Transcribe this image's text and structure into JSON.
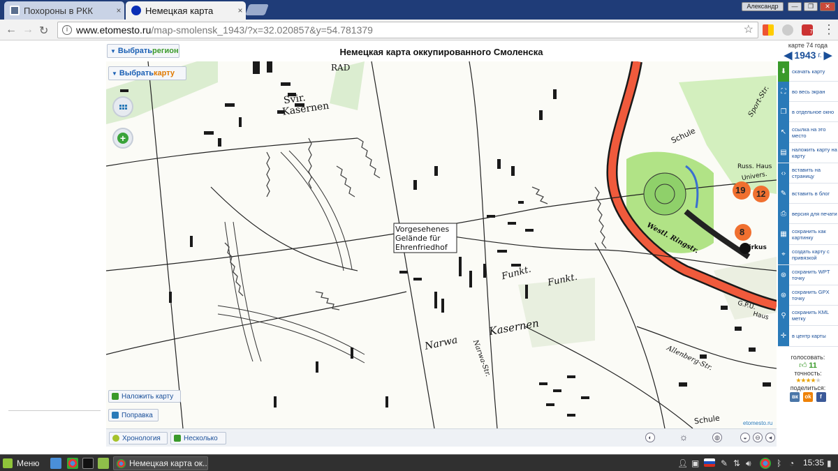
{
  "browser": {
    "tabs": [
      {
        "title": "Похороны в РКК",
        "active": false,
        "favicon": "page-icon"
      },
      {
        "title": "Немецкая карта",
        "active": true,
        "favicon": "blue-dot-icon"
      }
    ],
    "close_glyph": "×",
    "user_badge": "Александр",
    "window_controls": [
      "—",
      "❐",
      "✕"
    ],
    "url_host": "www.etomesto.ru",
    "url_path": "/map-smolensk_1943/?x=32.020857&y=54.781379",
    "info_glyph": "i",
    "star_glyph": "☆",
    "ext_badge": "7"
  },
  "page": {
    "title": "Немецкая карта оккупированного Смоленска",
    "select_region": {
      "prefix": "Выбрать ",
      "accent": "регион"
    },
    "select_map": {
      "prefix": "Выбрать ",
      "accent": "карту"
    },
    "dropdown_glyph": "▼",
    "overlay_map_button": "Наложить карту",
    "correction_button": "Поправка",
    "chronology_button": "Хронология",
    "several_button": "Несколько"
  },
  "map_labels": {
    "svir_kasernen_1": "Svir.",
    "svir_kasernen_2": "Kasernen",
    "rad": "RAD",
    "vorgesehenes": "Vorgesehenes",
    "gelande": "Gelände für",
    "ehrenfriedhof": "Ehrenfriedhof",
    "funkt1": "Funkt.",
    "funkt2": "Funkt.",
    "kasernen": "Kasernen",
    "narwa": "Narwa",
    "narwa_str": "Narwa-Str.",
    "schule1": "Schule",
    "schule2": "Schule",
    "sport_str": "Sport-Str.",
    "univers": "Univers.",
    "russ_haus": "Russ. Haus",
    "zirkus": "Zirkus",
    "num19": "19",
    "num12": "12",
    "num8": "8",
    "gpu": "G.P.U.",
    "haus": "Haus",
    "westl_ringstr": "Westl. Ringstr.",
    "allenberg_str": "Allenberg-Str.",
    "karte_credit": "etomesto.ru"
  },
  "sidebar": {
    "map_age_label": "карте 74 года",
    "year": "1943",
    "year_suffix": "г.",
    "prev_glyph": "◀",
    "next_glyph": "▶",
    "items": [
      {
        "label": "скачать карту",
        "icon": "download-icon",
        "color": "#3a9a2a"
      },
      {
        "label": "во весь экран",
        "icon": "fullscreen-icon",
        "color": "#2a7ab8"
      },
      {
        "label": "в отдельное окно",
        "icon": "window-icon",
        "color": "#2a7ab8"
      },
      {
        "label": "ссылка на это место",
        "icon": "link-icon",
        "color": "#2a7ab8"
      },
      {
        "label": "наложить карту на карту",
        "icon": "layers-icon",
        "color": "#2a7ab8"
      },
      {
        "label": "вставить на страницу",
        "icon": "code-icon",
        "color": "#2a7ab8"
      },
      {
        "label": "вставить в блог",
        "icon": "pencil-icon",
        "color": "#2a7ab8"
      },
      {
        "label": "версия для печати",
        "icon": "printer-icon",
        "color": "#2a7ab8"
      },
      {
        "label": "сохранить как картинку",
        "icon": "image-icon",
        "color": "#2a7ab8"
      },
      {
        "label": "создать карту с привязкой",
        "icon": "map-pin-icon",
        "color": "#2a7ab8"
      },
      {
        "label": "сохранить WPT точку",
        "icon": "gps-icon",
        "color": "#2a7ab8"
      },
      {
        "label": "сохранить GPX точку",
        "icon": "gps-icon",
        "color": "#2a7ab8"
      },
      {
        "label": "сохранить KML метку",
        "icon": "pin-icon",
        "color": "#2a7ab8"
      },
      {
        "label": "в центр карты",
        "icon": "target-icon",
        "color": "#2a7ab8"
      }
    ],
    "vote_label": "голосовать:",
    "vote_count": "11",
    "accuracy_label": "точность:",
    "accuracy_stars": "★★★★",
    "accuracy_empty": "★",
    "share_label": "поделиться:",
    "share": [
      {
        "label": "вк",
        "color": "#4a76a8"
      },
      {
        "label": "ok",
        "color": "#ee8208"
      },
      {
        "label": "f",
        "color": "#3b5998"
      }
    ]
  },
  "taskbar": {
    "menu_label": "Меню",
    "task_title": "Немецкая карта ок...",
    "time": "15:35"
  }
}
